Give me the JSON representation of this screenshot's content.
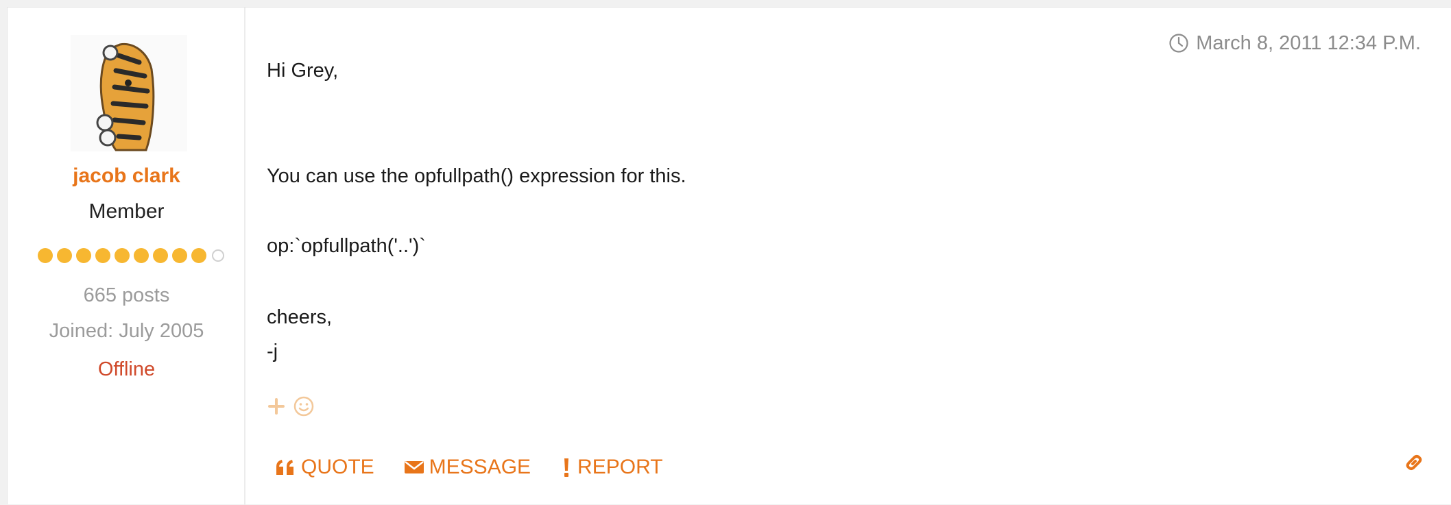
{
  "author": {
    "name": "jacob clark",
    "role": "Member",
    "rank_filled": 9,
    "rank_total": 10,
    "posts": "665 posts",
    "joined": "Joined: July 2005",
    "status": "Offline"
  },
  "post": {
    "timestamp": "March 8, 2011 12:34 P.M.",
    "lines": {
      "l1": "Hi Grey,",
      "l2": "You can use the opfullpath() expression for this.",
      "l3": "op:`opfullpath('..')`",
      "l4": "cheers,",
      "l5": "-j"
    }
  },
  "actions": {
    "quote": "QUOTE",
    "message": "MESSAGE",
    "report": "REPORT"
  },
  "colors": {
    "accent": "#e8751a",
    "rank_dot": "#f7b731",
    "status_offline": "#d04a2b",
    "muted_text": "#9b9b9b"
  },
  "icons": {
    "timestamp": "clock-icon",
    "add_reaction": "plus-icon",
    "emoji": "smiley-icon",
    "quote": "quote-icon",
    "message": "envelope-icon",
    "report": "exclamation-icon",
    "permalink": "link-icon"
  }
}
